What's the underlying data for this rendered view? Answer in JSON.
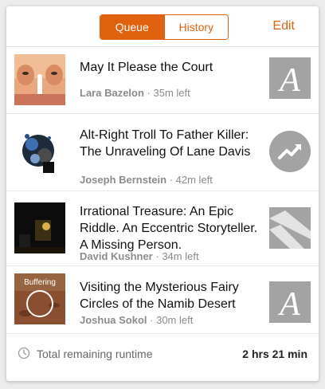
{
  "header": {
    "tabs": [
      {
        "label": "Queue",
        "active": true
      },
      {
        "label": "History",
        "active": false
      }
    ],
    "edit_label": "Edit"
  },
  "colors": {
    "accent": "#e0620e"
  },
  "items": [
    {
      "title": "May It Please the Court",
      "author": "Lara Bazelon",
      "time_left": "35m left",
      "publisher_icon": "atlantic-a-icon"
    },
    {
      "title": "Alt-Right Troll To Father Killer: The Unraveling Of Lane Davis",
      "author": "Joseph Bernstein",
      "time_left": "42m left",
      "publisher_icon": "trending-arrow-icon"
    },
    {
      "title": "Irrational Treasure: An Epic Riddle. An Eccentric Storyteller. A Missing Person.",
      "author": "David Kushner",
      "time_left": "34m left",
      "publisher_icon": "stripes-logo-icon"
    },
    {
      "title": "Visiting the Mysterious Fairy Circles of the Namib Desert",
      "author": "Joshua Sokol",
      "time_left": "30m left",
      "publisher_icon": "atlantic-a-icon",
      "status": "Buffering"
    }
  ],
  "footer": {
    "label": "Total remaining runtime",
    "value": "2 hrs 21 min"
  }
}
